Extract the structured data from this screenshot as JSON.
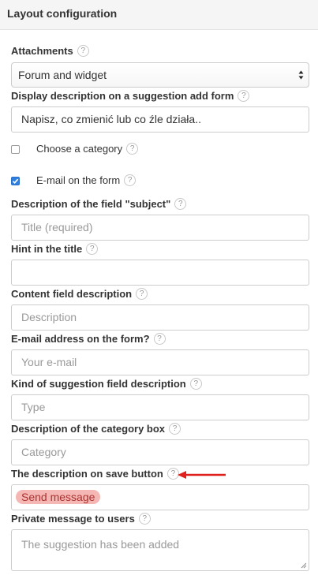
{
  "header": {
    "title": "Layout configuration"
  },
  "help_symbol": "?",
  "fields": {
    "attachments": {
      "label": "Attachments",
      "selected": "Forum and widget"
    },
    "display_description": {
      "label": "Display description on a suggestion add form",
      "value": "Napisz, co zmienić lub co źle działa.."
    },
    "choose_category": {
      "label": "Choose a category",
      "checked": false
    },
    "email_on_form": {
      "label": "E-mail on the form",
      "checked": true
    },
    "subject_description": {
      "label": "Description of the field \"subject\"",
      "placeholder": "Title (required)"
    },
    "title_hint": {
      "label": "Hint in the title",
      "placeholder": ""
    },
    "content_description": {
      "label": "Content field description",
      "placeholder": "Description"
    },
    "email_address": {
      "label": "E-mail address on the form?",
      "placeholder": "Your e-mail"
    },
    "kind_description": {
      "label": "Kind of suggestion field description",
      "placeholder": "Type"
    },
    "category_box": {
      "label": "Description of the category box",
      "placeholder": "Category"
    },
    "save_button_description": {
      "label": "The description on save button",
      "placeholder": "Send message"
    },
    "private_message": {
      "label": "Private message to users",
      "placeholder": "The suggestion has been added"
    }
  },
  "colors": {
    "checkbox_checked": "#2f7fe2",
    "annotation_arrow": "#e0201c",
    "annotation_highlight": "#f4b7b3"
  }
}
